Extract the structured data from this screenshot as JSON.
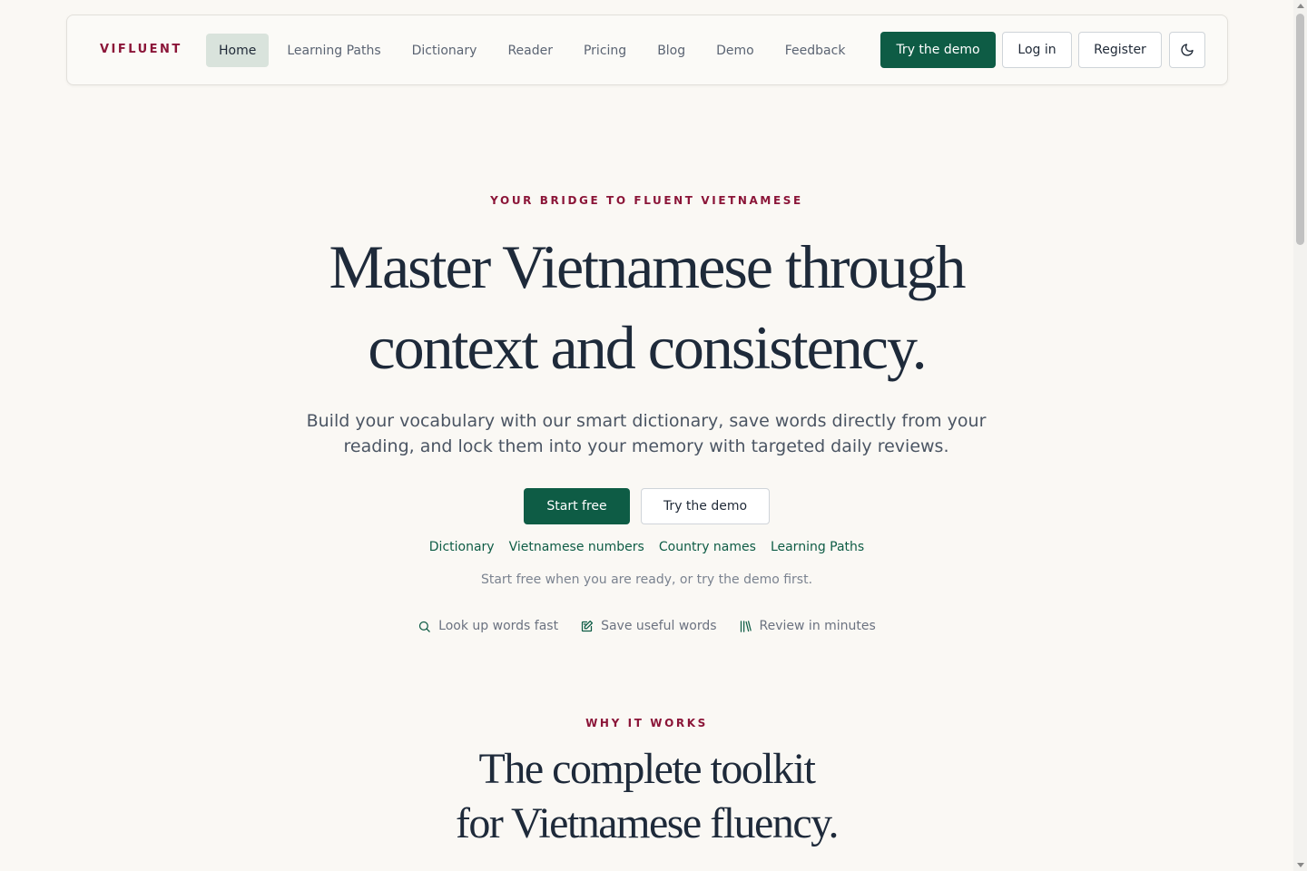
{
  "nav": {
    "brand": "VIFLUENT",
    "links": [
      {
        "label": "Home"
      },
      {
        "label": "Learning Paths"
      },
      {
        "label": "Dictionary"
      },
      {
        "label": "Reader"
      },
      {
        "label": "Pricing"
      },
      {
        "label": "Blog"
      },
      {
        "label": "Demo"
      },
      {
        "label": "Feedback"
      }
    ],
    "active": "Home",
    "try_demo": "Try the demo",
    "login": "Log in",
    "register": "Register",
    "theme_icon": "moon-icon"
  },
  "hero": {
    "eyebrow": "YOUR BRIDGE TO FLUENT VIETNAMESE",
    "title_line1": "Master Vietnamese through",
    "title_line2": "context and consistency.",
    "subtitle": "Build your vocabulary with our smart dictionary, save words directly from your reading, and lock them into your memory with targeted daily reviews.",
    "cta_primary": "Start free",
    "cta_secondary": "Try the demo",
    "quick_links": [
      "Dictionary",
      "Vietnamese numbers",
      "Country names",
      "Learning Paths"
    ],
    "hint": "Start free when you are ready, or try the demo first.",
    "features": [
      {
        "icon": "search-icon",
        "label": "Look up words fast"
      },
      {
        "icon": "edit-note-icon",
        "label": "Save useful words"
      },
      {
        "icon": "library-icon",
        "label": "Review in minutes"
      }
    ]
  },
  "why": {
    "eyebrow": "WHY IT WORKS",
    "title_line1": "The complete toolkit",
    "title_line2": "for Vietnamese fluency."
  },
  "colors": {
    "accent_green": "#0e5c45",
    "brand_crimson": "#8b1538",
    "background": "#faf8f4"
  }
}
